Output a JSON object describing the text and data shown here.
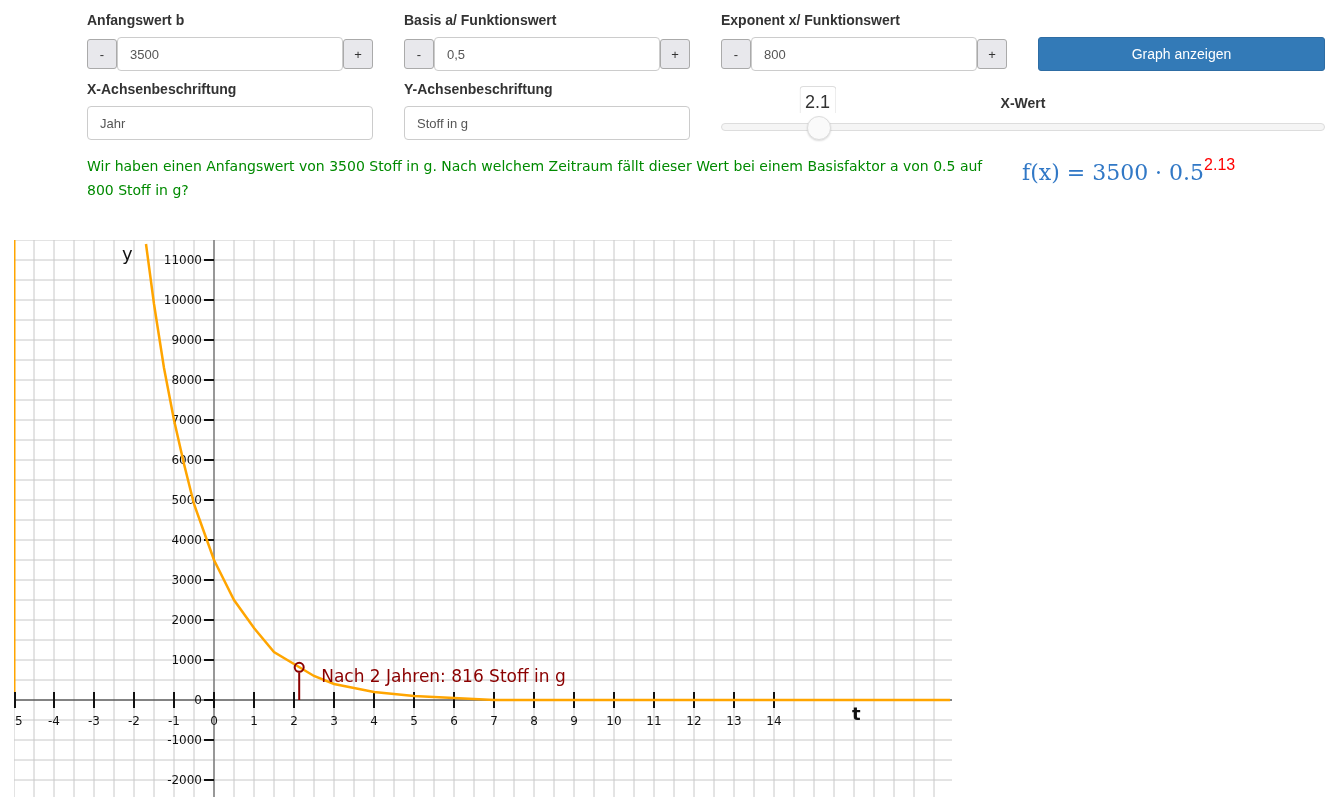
{
  "controls": [
    {
      "label": "Anfangswert b",
      "value": "3500",
      "minus": "-",
      "plus": "+"
    },
    {
      "label": "Basis a/ Funktionswert",
      "value": "0,5",
      "minus": "-",
      "plus": "+"
    },
    {
      "label": "Exponent x/ Funktionswert",
      "value": "800",
      "minus": "-",
      "plus": "+"
    }
  ],
  "show_button": "Graph anzeigen",
  "axis_fields": [
    {
      "label": "X-Achsenbeschriftung",
      "value": "Jahr"
    },
    {
      "label": "Y-Achsenbeschriftung",
      "value": "Stoff in g"
    }
  ],
  "slider": {
    "label": "X-Wert",
    "tooltip": "2.1",
    "level": 0.16
  },
  "question": "Wir haben einen Anfangswert von 3500 Stoff in g. Nach welchem Zeitraum fällt dieser Wert bei einem Basisfaktor a von 0.5 auf 800 Stoff in g?",
  "formula": {
    "text": "f(x) = 3500 · 0.5",
    "exponent": "2.13"
  },
  "chart_data": {
    "type": "line",
    "xlabel": "t",
    "ylabel": "y",
    "grid": true,
    "x": [
      -1.7,
      -1.5,
      -1.25,
      -1,
      -0.75,
      -0.5,
      -0.25,
      0,
      0.5,
      1,
      1.5,
      2,
      2.5,
      3,
      3.5,
      4,
      5,
      6,
      7,
      8,
      9,
      10,
      12,
      14,
      16,
      18.4
    ],
    "series": [
      {
        "color": "#ffa500",
        "values": [
          11400,
          9900,
          8300,
          7000,
          5900,
          4900,
          4200,
          3500,
          2500,
          1800,
          1200,
          900,
          600,
          400,
          300,
          200,
          100,
          50,
          0,
          0,
          0,
          0,
          0,
          0,
          0,
          0
        ]
      }
    ],
    "xlim": [
      -5,
      18.45
    ],
    "ylim": [
      -2500,
      11500
    ],
    "xticks": [
      {
        "value": -5,
        "label": "5"
      },
      -4,
      -3,
      -2,
      -1,
      0,
      1,
      2,
      3,
      4,
      5,
      6,
      7,
      8,
      9,
      10,
      11,
      12,
      13,
      14
    ],
    "yticks": [
      -2000,
      -1000,
      0,
      1000,
      2000,
      3000,
      4000,
      5000,
      6000,
      7000,
      8000,
      9000,
      10000,
      11000
    ],
    "annotations": [
      {
        "x": 2.13,
        "y": 816,
        "text": "Nach 2 Jahren: 816 Stoff in g"
      }
    ]
  }
}
